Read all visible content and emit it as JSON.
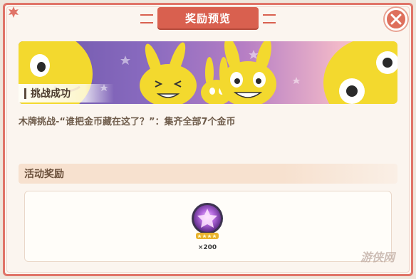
{
  "dialog": {
    "title": "奖励预览",
    "close_icon": "close-icon"
  },
  "banner": {
    "label": "挑战成功"
  },
  "description": "木牌挑战-“谁把金币藏在这了？”：集齐全部7个金币",
  "rewards": {
    "header": "活动奖励",
    "items": [
      {
        "icon": "purple-star-orb-icon",
        "quantity": "×200"
      }
    ]
  },
  "watermark": "游侠网",
  "colors": {
    "accent": "#d9604f",
    "frame": "#e07468",
    "background": "#fbf5ef"
  }
}
